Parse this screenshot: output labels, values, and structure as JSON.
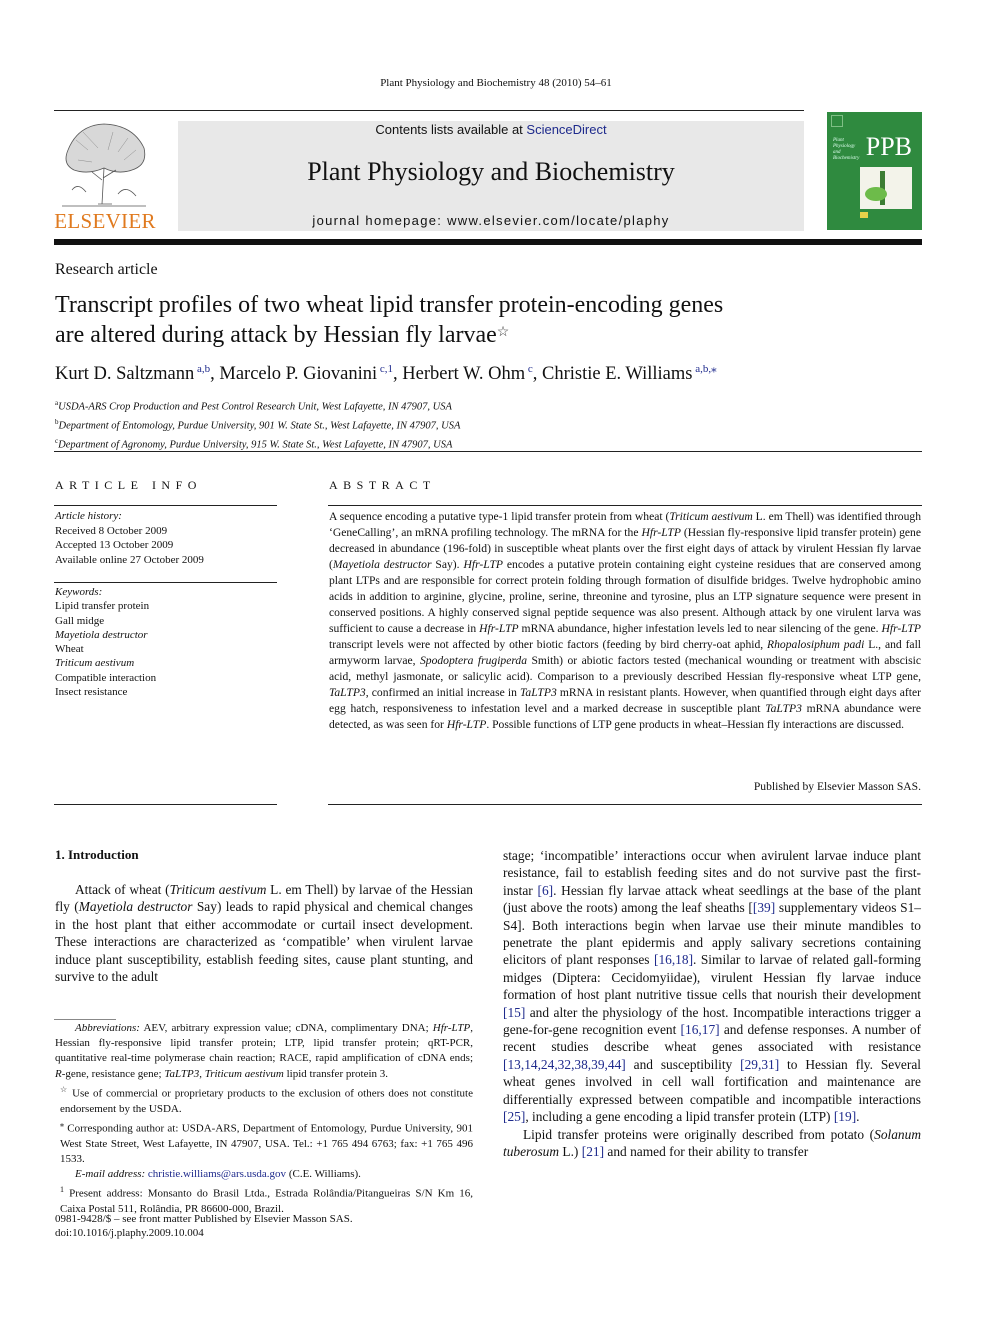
{
  "header": {
    "running_head": "Plant Physiology and Biochemistry 48 (2010) 54–61",
    "publisher_logo_text": "ELSEVIER",
    "contents_prefix": "Contents lists available at ",
    "contents_link": "ScienceDirect",
    "journal_name": "Plant Physiology and Biochemistry",
    "homepage": "journal homepage: www.elsevier.com/locate/plaphy",
    "cover_abbrev": "PPB",
    "cover_small": "Plant Physiology and Biochemistry",
    "colors": {
      "elsevier_orange": "#e07a1f",
      "cover_green": "#2f8a3f",
      "link_blue": "#1e2a8c",
      "banner_gray": "#e8e8e8"
    }
  },
  "article": {
    "type": "Research article",
    "title_line1": "Transcript profiles of two wheat lipid transfer protein-encoding genes",
    "title_line2": "are altered during attack by Hessian fly larvae",
    "title_mark": "☆",
    "authors": [
      {
        "name": "Kurt D. Saltzmann",
        "sup": "a,b",
        "sep": ", "
      },
      {
        "name": "Marcelo P. Giovanini",
        "sup": "c,1",
        "sep": ", "
      },
      {
        "name": "Herbert W. Ohm",
        "sup": "c",
        "sep": ", "
      },
      {
        "name": "Christie E. Williams",
        "sup": "a,b,⁎",
        "sep": ""
      }
    ],
    "affiliations": [
      {
        "mark": "a",
        "text": "USDA-ARS Crop Production and Pest Control Research Unit, West Lafayette, IN 47907, USA"
      },
      {
        "mark": "b",
        "text": "Department of Entomology, Purdue University, 901 W. State St., West Lafayette, IN 47907, USA"
      },
      {
        "mark": "c",
        "text": "Department of Agronomy, Purdue University, 915 W. State St., West Lafayette, IN 47907, USA"
      }
    ]
  },
  "article_info": {
    "heading": "ARTICLE INFO",
    "history_label": "Article history:",
    "history": [
      "Received 8 October 2009",
      "Accepted 13 October 2009",
      "Available online 27 October 2009"
    ],
    "keywords_label": "Keywords:",
    "keywords": [
      {
        "text": "Lipid transfer protein",
        "italic": false
      },
      {
        "text": "Gall midge",
        "italic": false
      },
      {
        "text": "Mayetiola destructor",
        "italic": true
      },
      {
        "text": "Wheat",
        "italic": false
      },
      {
        "text": "Triticum aestivum",
        "italic": true
      },
      {
        "text": "Compatible interaction",
        "italic": false
      },
      {
        "text": "Insect resistance",
        "italic": false
      }
    ]
  },
  "abstract": {
    "heading": "ABSTRACT",
    "segments": [
      [
        "A sequence encoding a putative type-1 lipid transfer protein from wheat (",
        0
      ],
      [
        "Triticum aestivum",
        1
      ],
      [
        " L. em Thell) was identified through ‘GeneCalling’, an mRNA profiling technology. The mRNA for the ",
        0
      ],
      [
        "Hfr-LTP",
        1
      ],
      [
        " (Hessian fly-responsive lipid transfer protein) gene decreased in abundance (196-fold) in susceptible wheat plants over the first eight days of attack by virulent Hessian fly larvae (",
        0
      ],
      [
        "Mayetiola destructor",
        1
      ],
      [
        " Say). ",
        0
      ],
      [
        "Hfr-LTP",
        1
      ],
      [
        " encodes a putative protein containing eight cysteine residues that are conserved among plant LTPs and are responsible for correct protein folding through formation of disulfide bridges. Twelve hydrophobic amino acids in addition to arginine, glycine, proline, serine, threonine and tyrosine, plus an LTP signature sequence were present in conserved positions. A highly conserved signal peptide sequence was also present. Although attack by one virulent larva was sufficient to cause a decrease in ",
        0
      ],
      [
        "Hfr-LTP",
        1
      ],
      [
        " mRNA abundance, higher infestation levels led to near silencing of the gene. ",
        0
      ],
      [
        "Hfr-LTP",
        1
      ],
      [
        " transcript levels were not affected by other biotic factors (feeding by bird cherry-oat aphid, ",
        0
      ],
      [
        "Rhopalosiphum padi",
        1
      ],
      [
        " L., and fall armyworm larvae, ",
        0
      ],
      [
        "Spodoptera frugiperda",
        1
      ],
      [
        " Smith) or abiotic factors tested (mechanical wounding or treatment with abscisic acid, methyl jasmonate, or salicylic acid). Comparison to a previously described Hessian fly-responsive wheat LTP gene, ",
        0
      ],
      [
        "TaLTP3",
        1
      ],
      [
        ", confirmed an initial increase in ",
        0
      ],
      [
        "TaLTP3",
        1
      ],
      [
        " mRNA in resistant plants. However, when quantified through eight days after egg hatch, responsiveness to infestation level and a marked decrease in susceptible plant ",
        0
      ],
      [
        "TaLTP3",
        1
      ],
      [
        " mRNA abundance were detected, as was seen for ",
        0
      ],
      [
        "Hfr-LTP",
        1
      ],
      [
        ". Possible functions of LTP gene products in wheat–Hessian fly interactions are discussed.",
        0
      ]
    ],
    "published": "Published by Elsevier Masson SAS."
  },
  "introduction": {
    "heading": "1.  Introduction",
    "p1": [
      [
        "Attack of wheat (",
        0
      ],
      [
        "Triticum aestivum",
        1
      ],
      [
        " L. em Thell) by larvae of the Hessian fly (",
        0
      ],
      [
        "Mayetiola destructor",
        1
      ],
      [
        " Say) leads to rapid physical and chemical changes in the host plant that either accommodate or curtail insect development. These interactions are characterized as ‘compatible’ when virulent larvae induce plant susceptibility, establish feeding sites, cause plant stunting, and survive to the adult",
        0
      ]
    ],
    "col2_p1": [
      [
        "stage; ‘incompatible’ interactions occur when avirulent larvae induce plant resistance, fail to establish feeding sites and do not survive past the first-instar ",
        0
      ],
      [
        "[6]",
        2
      ],
      [
        ". Hessian fly larvae attack wheat seedlings at the base of the plant (just above the roots) among the leaf sheaths [",
        0
      ],
      [
        "[39]",
        2
      ],
      [
        " supplementary videos S1–S4]. Both interactions begin when larvae use their minute mandibles to penetrate the plant epidermis and apply salivary secretions containing elicitors of plant responses ",
        0
      ],
      [
        "[16,18]",
        2
      ],
      [
        ". Similar to larvae of related gall-forming midges (Diptera: Cecidomyiidae), virulent Hessian fly larvae induce formation of host plant nutritive tissue cells that nourish their development ",
        0
      ],
      [
        "[15]",
        2
      ],
      [
        " and alter the physiology of the host. Incompatible interactions trigger a gene-for-gene recognition event ",
        0
      ],
      [
        "[16,17]",
        2
      ],
      [
        " and defense responses. A number of recent studies describe wheat genes associated with resistance ",
        0
      ],
      [
        "[13,14,24,32,38,39,44]",
        2
      ],
      [
        " and susceptibility ",
        0
      ],
      [
        "[29,31]",
        2
      ],
      [
        " to Hessian fly. Several wheat genes involved in cell wall fortification and maintenance are differentially expressed between compatible and incompatible interactions ",
        0
      ],
      [
        "[25]",
        2
      ],
      [
        ", including a gene encoding a lipid transfer protein (LTP) ",
        0
      ],
      [
        "[19]",
        2
      ],
      [
        ".",
        0
      ]
    ],
    "col2_p2": [
      [
        "Lipid transfer proteins were originally described from potato (",
        0
      ],
      [
        "Solanum tuberosum",
        1
      ],
      [
        " L.) ",
        0
      ],
      [
        "[21]",
        2
      ],
      [
        " and named for their ability to transfer",
        0
      ]
    ]
  },
  "footnotes": {
    "abbrev": [
      [
        "Abbreviations:",
        1
      ],
      [
        " AEV, arbitrary expression value; cDNA, complimentary DNA; ",
        0
      ],
      [
        "Hfr-LTP",
        1
      ],
      [
        ", Hessian fly-responsive lipid transfer protein; LTP, lipid transfer protein; qRT-PCR, quantitative real-time polymerase chain reaction; RACE, rapid amplification of cDNA ends; ",
        0
      ],
      [
        "R",
        1
      ],
      [
        "-gene, resistance gene; ",
        0
      ],
      [
        "TaLTP3",
        1
      ],
      [
        ", ",
        0
      ],
      [
        "Triticum aestivum",
        1
      ],
      [
        " lipid transfer protein 3.",
        0
      ]
    ],
    "star": [
      [
        "☆",
        3
      ],
      [
        " Use of commercial or proprietary products to the exclusion of others does not constitute endorsement by the USDA.",
        0
      ]
    ],
    "corresponding": [
      [
        "⁎",
        3
      ],
      [
        " Corresponding author at: USDA-ARS, Department of Entomology, Purdue University, 901 West State Street, West Lafayette, IN 47907, USA. Tel.: +1 765 494 6763; fax: +1 765 496 1533.",
        0
      ]
    ],
    "email": [
      [
        "E-mail address:",
        1
      ],
      [
        " ",
        0
      ],
      [
        "christie.williams@ars.usda.gov",
        2
      ],
      [
        " (C.E. Williams).",
        0
      ]
    ],
    "present": [
      [
        "1",
        3
      ],
      [
        " Present address: Monsanto do Brasil Ltda., Estrada Rolândia/Pitangueiras S/N Km 16, Caixa Postal 511, Rolândia, PR 86600-000, Brazil.",
        0
      ]
    ]
  },
  "front_matter": {
    "issn": "0981-9428/$ – see front matter Published by Elsevier Masson SAS.",
    "doi": "doi:10.1016/j.plaphy.2009.10.004"
  }
}
